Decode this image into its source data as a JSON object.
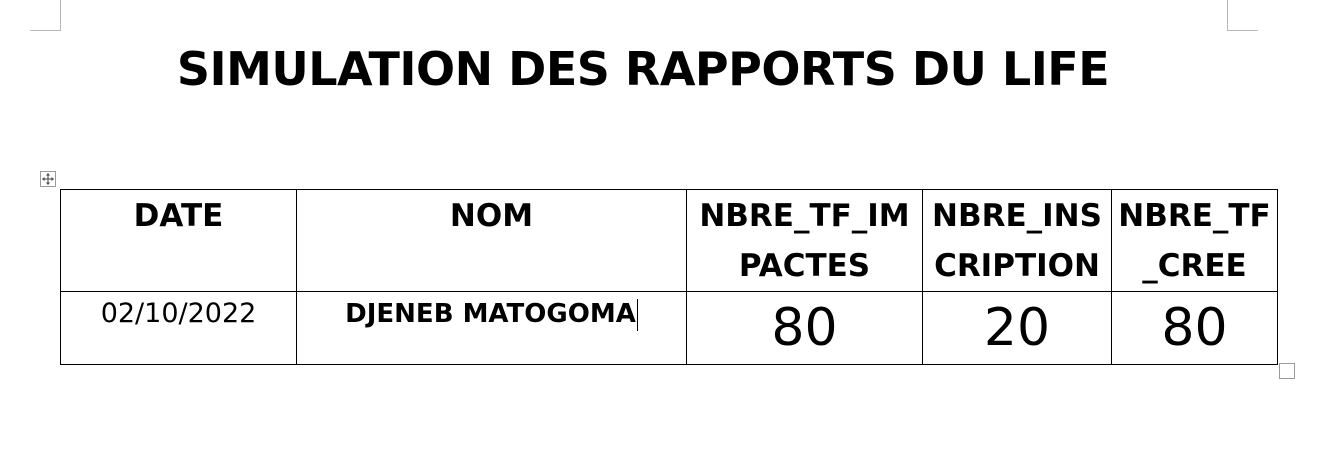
{
  "document": {
    "title": "SIMULATION DES RAPPORTS DU LIFE"
  },
  "table": {
    "headers": {
      "date": "DATE",
      "nom": "NOM",
      "nbre_tf_impactes": "NBRE_TF_IMPACTES",
      "nbre_inscription": "NBRE_INSCRIPTION",
      "nbre_tf_cree": "NBRE_TF_CREE"
    },
    "rows": [
      {
        "date": "02/10/2022",
        "nom": "DJENEB MATOGOMA",
        "nbre_tf_impactes": "80",
        "nbre_inscription": "20",
        "nbre_tf_cree": "80"
      }
    ]
  },
  "icons": {
    "table_move": "move-arrows-icon",
    "table_resize": "resize-square-icon"
  }
}
